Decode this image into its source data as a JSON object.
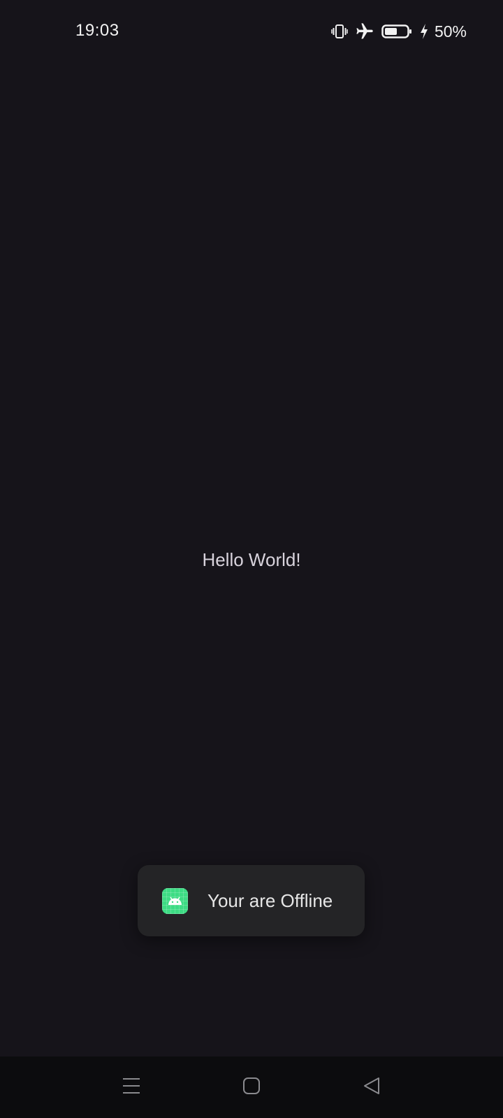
{
  "status_bar": {
    "time": "19:03",
    "battery_percent": "50%",
    "icons": [
      "vibrate-icon",
      "airplane-mode-icon",
      "battery-icon",
      "charging-bolt-icon"
    ]
  },
  "main": {
    "center_text": "Hello World!"
  },
  "toast": {
    "icon": "android-app-icon",
    "message": "Your are Offline",
    "icon_color": "#3ddc84"
  },
  "nav_bar": {
    "buttons": [
      "menu-icon",
      "home-icon",
      "back-icon"
    ]
  },
  "colors": {
    "background": "#16141a",
    "toast_background": "#242426",
    "nav_background": "#0c0c0e"
  }
}
